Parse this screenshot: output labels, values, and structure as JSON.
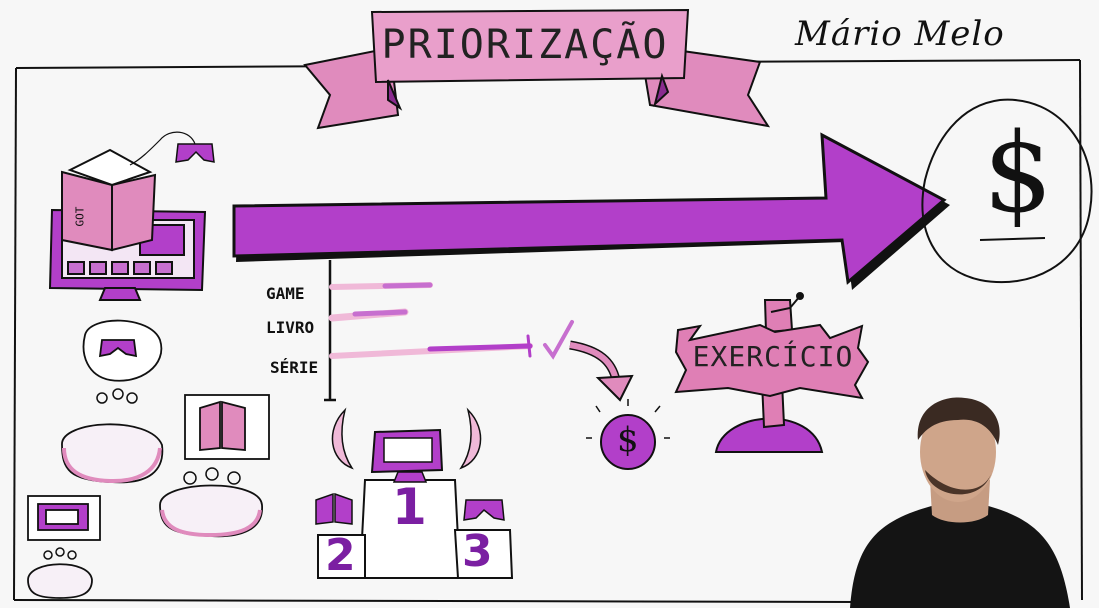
{
  "banner": {
    "title": "PRIORIZAÇÃO"
  },
  "signature": "Mário Melo",
  "goal": {
    "symbol": "$"
  },
  "priority_list": {
    "items": [
      {
        "label": "GAME"
      },
      {
        "label": "LIVRO"
      },
      {
        "label": "SÉRIE"
      }
    ]
  },
  "podium": {
    "places": [
      "1",
      "2",
      "3"
    ]
  },
  "coin": {
    "symbol": "$"
  },
  "exercise_sign": {
    "text": "EXERCÍCIO"
  },
  "book_cover": {
    "text": "GOT"
  },
  "colors": {
    "accent": "#b23fc9",
    "accent_dark": "#7b1fa2",
    "pink": "#df7fb5",
    "light_pink": "#f0a5cf",
    "ink": "#111111"
  },
  "icons": [
    "gamepad-icon",
    "book-icon",
    "monitor-icon",
    "dollar-icon",
    "checkmark-icon",
    "laurel-icon",
    "person-icon"
  ]
}
